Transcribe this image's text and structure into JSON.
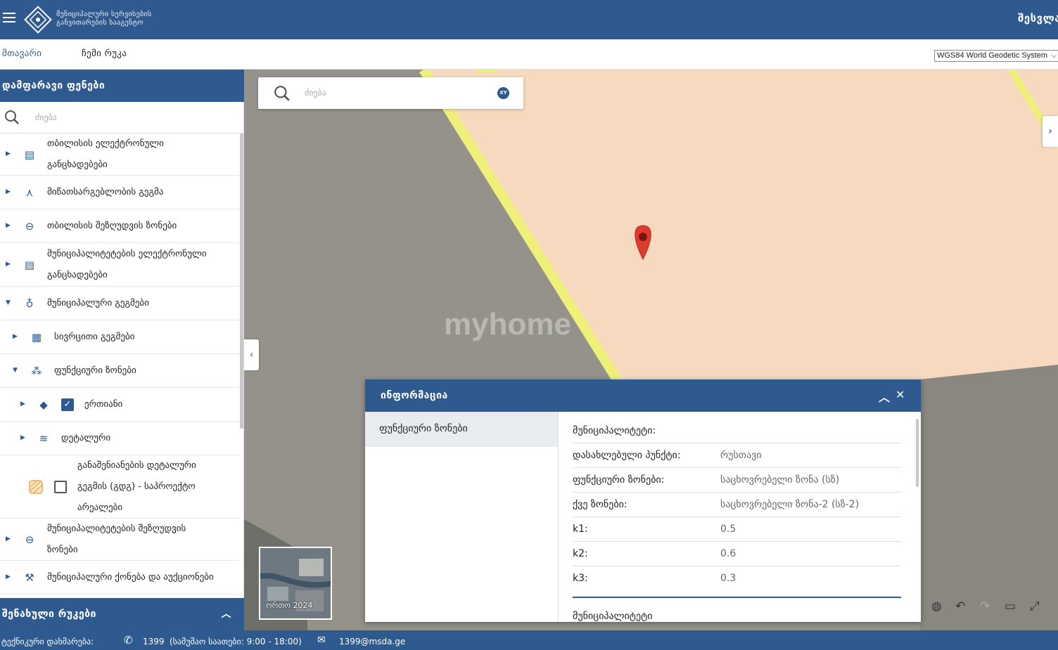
{
  "header": {
    "org_line1": "მუნიციპალური სერვისების",
    "org_line2": "განვითარების სააგენტო",
    "right_label": "შესვლა"
  },
  "nav": {
    "main": "მთავარი",
    "my_map": "ჩემი რუკა",
    "crs_value": "WGS84 World Geodetic System"
  },
  "sidebar": {
    "title": "დამფარავი ფენები",
    "search_placeholder": "ძიება",
    "layers": [
      {
        "line1": "თბილისის ელექტრონული",
        "line2": "განცხადებები",
        "icon": "document-icon"
      },
      {
        "line1": "მიწათსარგებლობის გეგმა",
        "icon": "compass-icon"
      },
      {
        "line1": "თბილისის შეზღუდვის ზონები",
        "icon": "restriction-icon"
      },
      {
        "line1": "მუნიციპალიტეტების ელექტრონული",
        "line2": "განცხადებები",
        "icon": "document-icon"
      },
      {
        "line1": "მუნიციპალური გეგმები",
        "icon": "pin-icon"
      },
      {
        "line1": "სივრცითი გეგმები",
        "icon": "grid-icon"
      },
      {
        "line1": "ფუნქციური ზონები",
        "icon": "zones-icon"
      },
      {
        "line1": "ერთიანი",
        "icon": "diamond-icon"
      },
      {
        "line1": "დეტალური",
        "icon": "layers-icon"
      },
      {
        "line1": "განაშენიანების დეტალური",
        "line2": "გეგმის (გდგ) - საპროექტო",
        "line3": "არეალები",
        "icon": "hatch-icon"
      },
      {
        "line1": "მუნიციპალიტეტების შეზღუდვის",
        "line2": "ზონები",
        "icon": "restriction-icon"
      },
      {
        "line1": "მუნიციპალური ქონება და აუქციონები",
        "icon": "gavel-icon"
      }
    ],
    "footer_title": "შენახული რუკები"
  },
  "map": {
    "search_placeholder": "ძიება",
    "xy_label": "XY",
    "watermark": "myhome",
    "basemap_caption": "ორთო 2024"
  },
  "info_panel": {
    "title": "ინფორმაცია",
    "tab": "ფუნქციური ზონები",
    "rows": [
      {
        "key": "მუნიციპალიტეტი:",
        "value": ""
      },
      {
        "key": "დასახლებული პუნქტი:",
        "value": "რუსთავი"
      },
      {
        "key": "ფუნქციური ზონები:",
        "value": "საცხოვრებელი ზონა (სზ)"
      },
      {
        "key": "ქვე ზონები:",
        "value": "საცხოვრებელი ზონა-2 (სზ-2)"
      },
      {
        "key": "k1:",
        "value": "0.5"
      },
      {
        "key": "k2:",
        "value": "0.6"
      },
      {
        "key": "k3:",
        "value": "0.3"
      }
    ],
    "cut_text": "მუნიციპალიტეტი"
  },
  "footer": {
    "support_label": "ტექნიკური დახმარება:",
    "phone": "1399",
    "hours": "(სამუშაო საათები: 9:00 - 18:00)",
    "email": "1399@msda.ge"
  },
  "colors": {
    "brand": "#2e5a8f",
    "zone_fill": "#f7d9bf",
    "zone_border": "#eef07a",
    "marker": "#e03a2f"
  }
}
